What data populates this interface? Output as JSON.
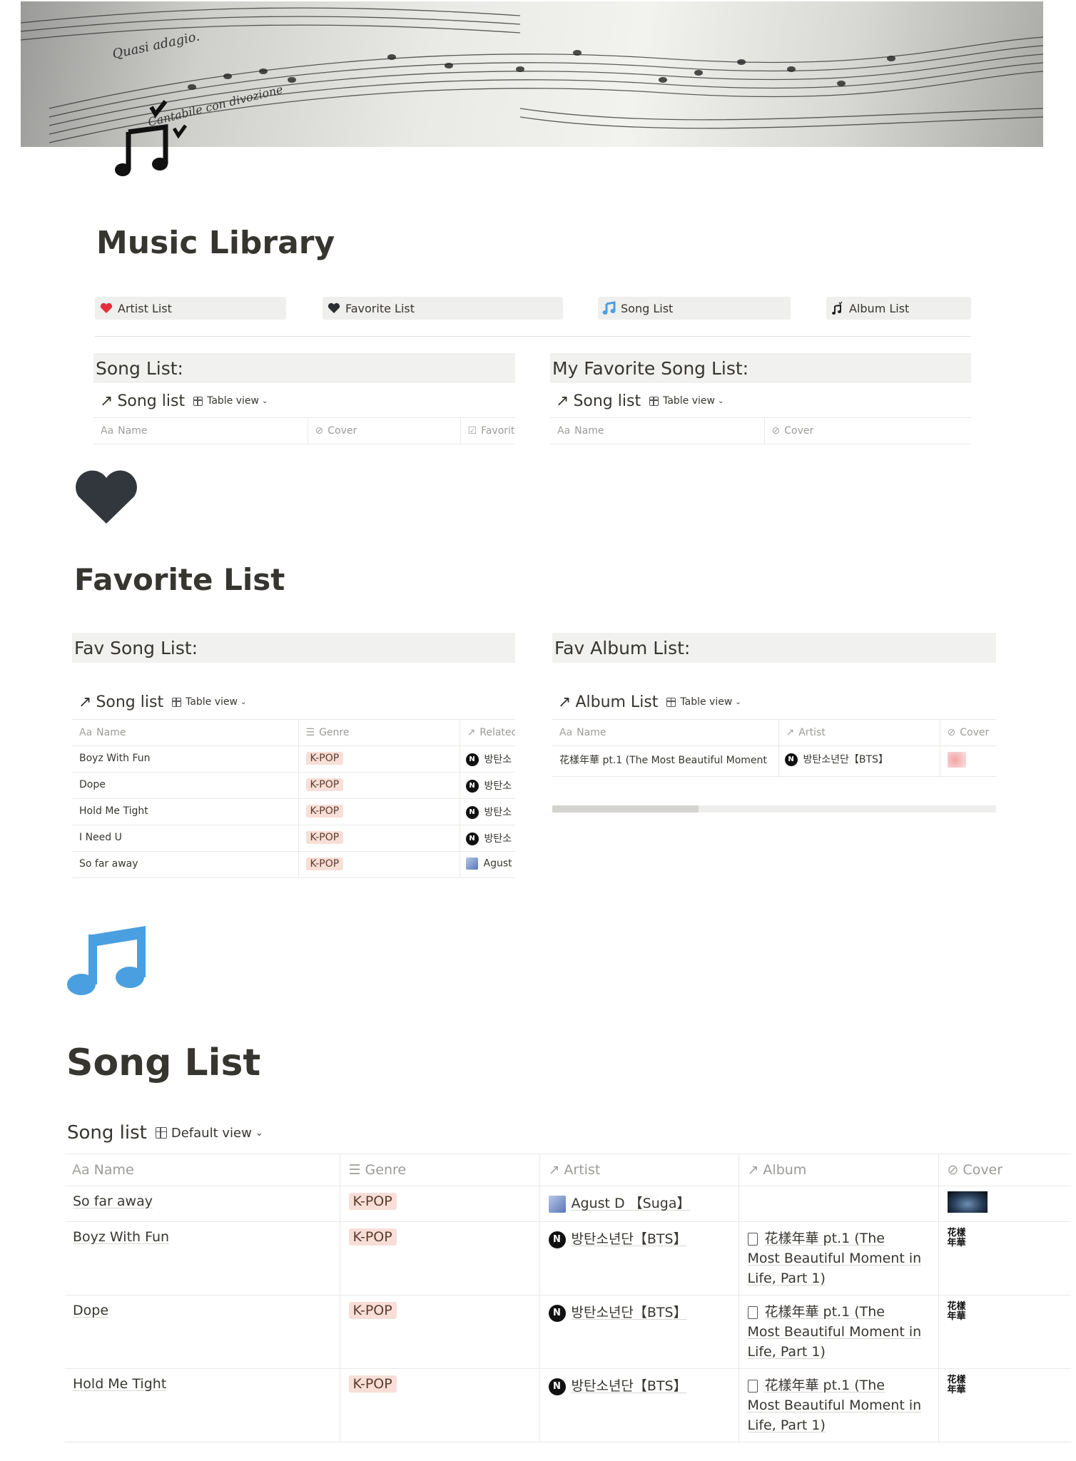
{
  "page": {
    "title": "Music Library",
    "cover_icon": "music-note-icon"
  },
  "nav": [
    {
      "label": "Artist List",
      "icon": "red-heart-icon"
    },
    {
      "label": "Favorite List",
      "icon": "black-heart-icon"
    },
    {
      "label": "Song List",
      "icon": "blue-music-note-icon"
    },
    {
      "label": "Album List",
      "icon": "music-note-icon"
    }
  ],
  "top_section": {
    "left_callout": "Song List:",
    "right_callout": "My Favorite Song List:",
    "left_db": {
      "title": "Song list",
      "view": "Table view",
      "columns": [
        "Name",
        "Cover",
        "Favorit"
      ]
    },
    "right_db": {
      "title": "Song list",
      "view": "Table view",
      "columns": [
        "Name",
        "Cover"
      ]
    }
  },
  "favorite": {
    "icon": "black-heart-icon",
    "title": "Favorite List",
    "song_callout": "Fav Song List:",
    "album_callout": "Fav Album List:",
    "song_db": {
      "title": "Song list",
      "view": "Table view",
      "columns": [
        "Name",
        "Genre",
        "Relatec"
      ],
      "rows": [
        {
          "name": "Boyz With Fun",
          "genre": "K-POP",
          "related": "방탄소"
        },
        {
          "name": "Dope",
          "genre": "K-POP",
          "related": "방탄소"
        },
        {
          "name": "Hold Me Tight",
          "genre": "K-POP",
          "related": "방탄소"
        },
        {
          "name": "I Need U",
          "genre": "K-POP",
          "related": "방탄소"
        },
        {
          "name": "So far away",
          "genre": "K-POP",
          "related": "Agust"
        }
      ]
    },
    "album_db": {
      "title": "Album List",
      "view": "Table view",
      "columns": [
        "Name",
        "Artist",
        "Cover"
      ],
      "rows": [
        {
          "name": "花樣年華 pt.1 (The Most Beautiful Moment",
          "artist": "방탄소년단【BTS】"
        }
      ],
      "scroll_fraction": 0.33
    }
  },
  "songlist": {
    "icon": "blue-music-note-icon",
    "title": "Song List",
    "db": {
      "title": "Song list",
      "view": "Default view",
      "columns": [
        "Name",
        "Genre",
        "Artist",
        "Album",
        "Cover"
      ],
      "rows": [
        {
          "name": "So far away",
          "genre": "K-POP",
          "artist": "Agust D 【Suga】",
          "album_l1": "",
          "album_l2": "",
          "album_l3": ""
        },
        {
          "name": "Boyz With Fun",
          "genre": "K-POP",
          "artist": "방탄소년단【BTS】",
          "album_l1": "花樣年華 pt.1 (The",
          "album_l2": "Most Beautiful Moment in",
          "album_l3": "Life, Part 1)",
          "cover": "花樣 年華"
        },
        {
          "name": "Dope",
          "genre": "K-POP",
          "artist": "방탄소년단【BTS】",
          "album_l1": "花樣年華 pt.1 (The",
          "album_l2": "Most Beautiful Moment in",
          "album_l3": "Life, Part 1)",
          "cover": "花樣 年華"
        },
        {
          "name": "Hold Me Tight",
          "genre": "K-POP",
          "artist": "방탄소년단【BTS】",
          "album_l1": "花樣年華 pt.1 (The",
          "album_l2": "Most Beautiful Moment in",
          "album_l3": "Life, Part 1)",
          "cover": "花樣 年華"
        }
      ]
    }
  }
}
